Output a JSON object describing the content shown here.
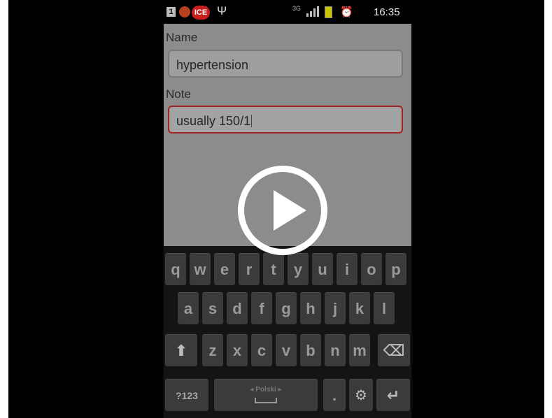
{
  "status_bar": {
    "sim_icon": "sim-card-icon",
    "sim_label": "1",
    "app_icon": "app-notification-icon",
    "ice_badge": "ICE",
    "usb_icon": "usb-icon",
    "data_label": "3G",
    "signal_icon": "signal-strength-icon",
    "battery_icon": "battery-icon",
    "alarm_icon": "alarm-icon",
    "time": "16:35"
  },
  "form": {
    "name_label": "Name",
    "name_value": "hypertension",
    "note_label": "Note",
    "note_value": "usually 150/1"
  },
  "video": {
    "play_icon": "play-icon"
  },
  "keyboard": {
    "row1": [
      "q",
      "w",
      "e",
      "r",
      "t",
      "y",
      "u",
      "i",
      "o",
      "p"
    ],
    "row2": [
      "a",
      "s",
      "d",
      "f",
      "g",
      "h",
      "j",
      "k",
      "l"
    ],
    "row3": [
      "z",
      "x",
      "c",
      "v",
      "b",
      "n",
      "m"
    ],
    "numbers_label": "?123",
    "space_label": "◂ Polski ▸",
    "period_label": ".",
    "shift_icon": "shift-icon",
    "backspace_icon": "backspace-icon",
    "settings_icon": "gear-icon",
    "enter_icon": "enter-icon"
  },
  "colors": {
    "note_field_border": "#a02424",
    "ice_badge": "#c81e1e"
  }
}
